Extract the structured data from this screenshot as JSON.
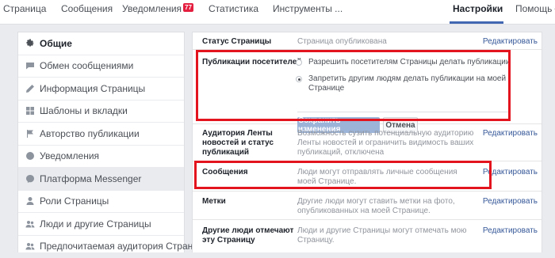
{
  "topnav": {
    "tabs": [
      {
        "label": "Страница"
      },
      {
        "label": "Сообщения"
      },
      {
        "label": "Уведомления",
        "badge": "77"
      },
      {
        "label": "Статистика"
      },
      {
        "label": "Инструменты ..."
      },
      {
        "label": "Настройки",
        "active": true
      },
      {
        "label": "Помощь"
      }
    ]
  },
  "sidebar": {
    "items": [
      {
        "label": "Общие",
        "icon": "gear-icon",
        "active": true
      },
      {
        "label": "Обмен сообщениями",
        "icon": "chat-icon"
      },
      {
        "label": "Информация Страницы",
        "icon": "pencil-icon"
      },
      {
        "label": "Шаблоны и вкладки",
        "icon": "grid-icon"
      },
      {
        "label": "Авторство публикации",
        "icon": "flag-icon"
      },
      {
        "label": "Уведомления",
        "icon": "globe-icon"
      },
      {
        "label": "Платформа Messenger",
        "icon": "messenger-icon",
        "highlight": true
      },
      {
        "label": "Роли Страницы",
        "icon": "person-icon"
      },
      {
        "label": "Люди и другие Страницы",
        "icon": "people-icon"
      },
      {
        "label": "Предпочитаемая аудитория Страницы",
        "icon": "people-icon"
      }
    ]
  },
  "settings": {
    "edit_label": "Редактировать",
    "status": {
      "label": "Статус Страницы",
      "value": "Страница опубликована"
    },
    "visitor_posts": {
      "label": "Публикации посетителей",
      "option_allow": "Разрешить посетителям Страницы делать публикации",
      "option_deny": "Запретить другим людям делать публикации на моей Странице",
      "selected": "deny",
      "save_label": "Сохранить изменения",
      "cancel_label": "Отмена"
    },
    "audience": {
      "label": "Аудитория Ленты новостей и статус публикаций",
      "value": "Возможность сузить потенциальную аудиторию Ленты новостей и ограничить видимость ваших публикаций, отключена"
    },
    "messages": {
      "label": "Сообщения",
      "value": "Люди могут отправлять личные сообщения моей Странице."
    },
    "tags": {
      "label": "Метки",
      "value": "Другие люди могут ставить метки на фото, опубликованных на моей Странице."
    },
    "others_tag": {
      "label": "Другие люди отмечают эту Страницу",
      "value": "Люди и другие Страницы могут отмечать мою Страницу."
    }
  },
  "colors": {
    "accent": "#4267b2",
    "link": "#365899",
    "highlight_box": "#e3141d",
    "save_button": "#9cb4d8"
  }
}
